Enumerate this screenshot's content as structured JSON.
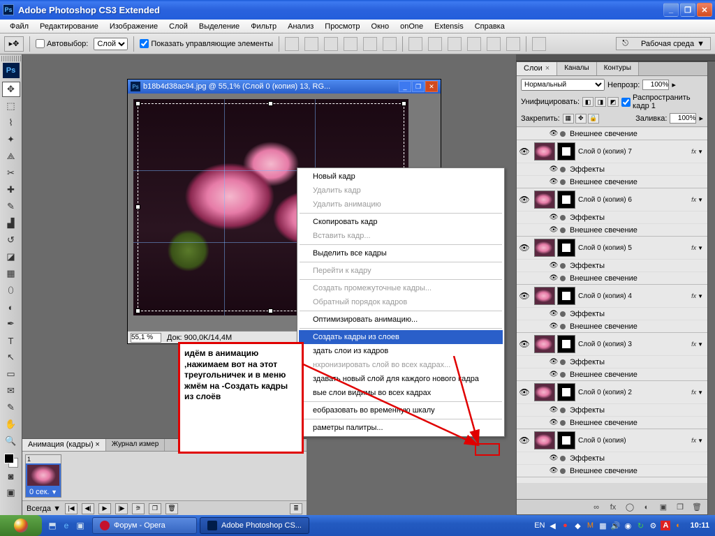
{
  "app": {
    "title": "Adobe Photoshop CS3 Extended",
    "icon": "Ps"
  },
  "menu": [
    "Файл",
    "Редактирование",
    "Изображение",
    "Слой",
    "Выделение",
    "Фильтр",
    "Анализ",
    "Просмотр",
    "Окно",
    "onOne",
    "Extensis",
    "Справка"
  ],
  "options": {
    "autoselect_label": "Автовыбор:",
    "autoselect_target": "Слой",
    "show_controls": "Показать управляющие элементы",
    "workspace": "Рабочая среда"
  },
  "document": {
    "title": "b18b4d38ac94.jpg @ 55,1% (Слой 0 (копия) 13, RG...",
    "zoom": "55,1 %",
    "doc_info": "Док: 900,0K/14,4M"
  },
  "context_menu": {
    "items": [
      {
        "label": "Новый кадр",
        "enabled": true
      },
      {
        "label": "Удалить кадр",
        "enabled": false
      },
      {
        "label": "Удалить анимацию",
        "enabled": false
      },
      {
        "sep": true
      },
      {
        "label": "Скопировать кадр",
        "enabled": true
      },
      {
        "label": "Вставить кадр...",
        "enabled": false
      },
      {
        "sep": true
      },
      {
        "label": "Выделить все кадры",
        "enabled": true
      },
      {
        "sep": true
      },
      {
        "label": "Перейти к кадру",
        "enabled": false
      },
      {
        "sep": true
      },
      {
        "label": "Создать промежуточные кадры...",
        "enabled": false
      },
      {
        "label": "Обратный порядок кадров",
        "enabled": false
      },
      {
        "sep": true
      },
      {
        "label": "Оптимизировать анимацию...",
        "enabled": true
      },
      {
        "sep": true
      },
      {
        "label": "Создать кадры из слоев",
        "enabled": true,
        "highlight": true
      },
      {
        "label": "Создать слои из кадров",
        "enabled": true,
        "obscured": "здать слои из кадров"
      },
      {
        "label": "Синхронизировать слой во всех кадрах...",
        "enabled": false,
        "obscured": "нхронизировать слой во всех кадрах..."
      },
      {
        "label": "Создавать новый слой для каждого нового кадра",
        "enabled": true,
        "obscured": "здавать новый слой для каждого нового кадра"
      },
      {
        "label": "Новые слои видимы во всех кадрах",
        "enabled": true,
        "obscured": "вые слои видимы во всех кадрах"
      },
      {
        "sep": true
      },
      {
        "label": "Преобразовать во временную шкалу",
        "enabled": true,
        "obscured": "еобразовать во временную шкалу"
      },
      {
        "sep": true
      },
      {
        "label": "Параметры палитры...",
        "enabled": true,
        "obscured": "раметры палитры..."
      }
    ]
  },
  "annotation": "идём в анимацию ,нажимаем вот на этот треугольничек и в меню жмём на -Создать кадры из слоёв",
  "layers_panel": {
    "tabs": [
      "Слои",
      "Каналы",
      "Контуры"
    ],
    "blend_mode": "Нормальный",
    "opacity_label": "Непрозр:",
    "opacity": "100%",
    "unify_label": "Унифицировать:",
    "propagate": "Распространить кадр 1",
    "lock_label": "Закрепить:",
    "fill_label": "Заливка:",
    "fill": "100%",
    "outer_glow_top": "Внешнее свечение",
    "layers": [
      {
        "name": "Слой 0 (копия) 7",
        "fx": true,
        "effects": "Эффекты",
        "glow": "Внешнее свечение"
      },
      {
        "name": "Слой 0 (копия) 6",
        "fx": true,
        "effects": "Эффекты",
        "glow": "Внешнее свечение"
      },
      {
        "name": "Слой 0 (копия) 5",
        "fx": true,
        "effects": "Эффекты",
        "glow": "Внешнее свечение"
      },
      {
        "name": "Слой 0 (копия) 4",
        "fx": true,
        "effects": "Эффекты",
        "glow": "Внешнее свечение"
      },
      {
        "name": "Слой 0 (копия) 3",
        "fx": true,
        "effects": "Эффекты",
        "glow": "Внешнее свечение"
      },
      {
        "name": "Слой 0 (копия) 2",
        "fx": true,
        "effects": "Эффекты",
        "glow": "Внешнее свечение"
      },
      {
        "name": "Слой 0 (копия)",
        "fx": true,
        "effects": "Эффекты",
        "glow": "Внешнее свечение"
      }
    ]
  },
  "animation_panel": {
    "tabs": [
      "Анимация (кадры)",
      "Журнал измер"
    ],
    "frame_num": "1",
    "frame_time": "0 сек.",
    "loop": "Всегда"
  },
  "taskbar": {
    "lang": "EN",
    "tasks": [
      {
        "label": "Форум - Opera",
        "active": false,
        "icon": "opera"
      },
      {
        "label": "Adobe Photoshop CS...",
        "active": true,
        "icon": "ps"
      }
    ],
    "clock": "10:11"
  }
}
